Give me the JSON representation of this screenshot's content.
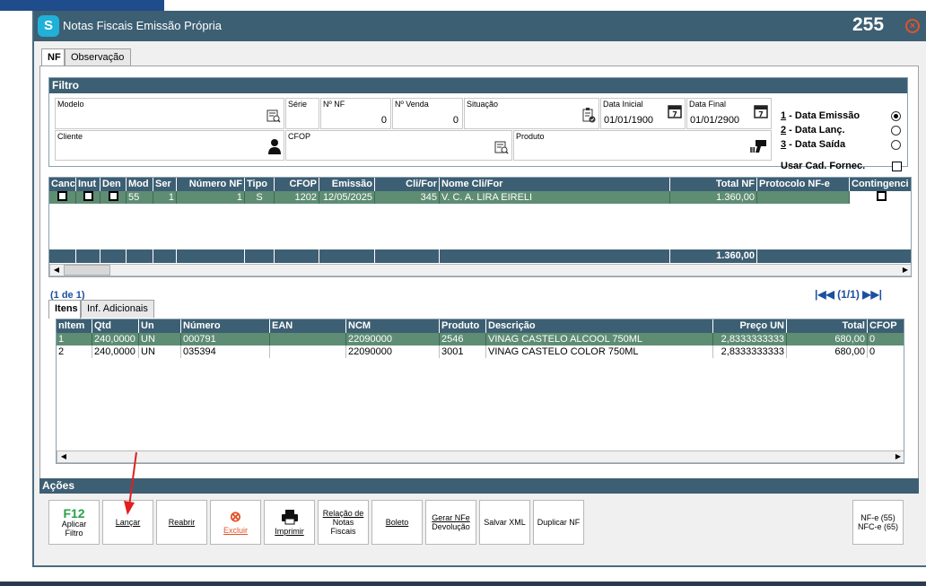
{
  "window": {
    "title": "Notas Fiscais Emissão Própria",
    "number": "255"
  },
  "tabs": [
    {
      "label": "NF",
      "active": true
    },
    {
      "label": "Observação",
      "active": false
    }
  ],
  "filtro": {
    "title": "Filtro",
    "modelo": {
      "label": "Modelo",
      "value": ""
    },
    "serie": {
      "label": "Série",
      "value": ""
    },
    "nnf": {
      "label": "Nº NF",
      "value": "0"
    },
    "nvenda": {
      "label": "Nº Venda",
      "value": "0"
    },
    "situacao": {
      "label": "Situação",
      "value": ""
    },
    "data_inicial": {
      "label": "Data Inicial",
      "value": "01/01/1900"
    },
    "data_final": {
      "label": "Data Final",
      "value": "01/01/2900"
    },
    "cliente": {
      "label": "Cliente",
      "value": ""
    },
    "cfop": {
      "label": "CFOP",
      "value": ""
    },
    "produto": {
      "label": "Produto",
      "value": ""
    },
    "radios": [
      {
        "key": "1",
        "label": " - Data Emissão",
        "checked": true
      },
      {
        "key": "2",
        "label": " - Data Lanç.",
        "checked": false
      },
      {
        "key": "3",
        "label": " - Data Saída",
        "checked": false
      }
    ],
    "usar_cad_fornec": "Usar Cad. Fornec."
  },
  "nf_grid": {
    "headers": [
      "Canc",
      "Inut",
      "Den",
      "Mod",
      "Ser",
      "Número NF",
      "Tipo",
      "CFOP",
      "Emissão",
      "Cli/For",
      "Nome Cli/For",
      "Total NF",
      "Protocolo NF-e",
      "Contingenci"
    ],
    "rows": [
      {
        "mod": "55",
        "ser": "1",
        "numero": "1",
        "tipo": "S",
        "cfop": "1202",
        "emissao": "12/05/2025",
        "clifor": "345",
        "nome": "V. C. A. LIRA EIRELI",
        "total": "1.360,00",
        "protocolo": ""
      }
    ],
    "footer_total": "1.360,00",
    "pager_left": "(1 de 1)",
    "pager_right": "(1/1)"
  },
  "item_tabs": [
    {
      "label": "Itens",
      "active": true
    },
    {
      "label": "Inf. Adicionais",
      "active": false
    }
  ],
  "items_grid": {
    "headers": [
      "nItem",
      "Qtd",
      "Un",
      "Número",
      "EAN",
      "NCM",
      "Produto",
      "Descrição",
      "Preço UN",
      "Total",
      "CFOP"
    ],
    "rows": [
      {
        "nitem": "1",
        "qtd": "240,0000",
        "un": "UN",
        "numero": "000791",
        "ean": "",
        "ncm": "22090000",
        "produto": "2546",
        "descricao": "VINAG CASTELO ALCOOL 750ML",
        "preco": "2,8333333333",
        "total": "680,00",
        "cfop": "0"
      },
      {
        "nitem": "2",
        "qtd": "240,0000",
        "un": "UN",
        "numero": "035394",
        "ean": "",
        "ncm": "22090000",
        "produto": "3001",
        "descricao": "VINAG CASTELO COLOR 750ML",
        "preco": "2,8333333333",
        "total": "680,00",
        "cfop": "0"
      }
    ]
  },
  "acoes": {
    "title": "Ações",
    "aplicar_icon_text": "F12",
    "aplicar_line1": "Aplicar",
    "aplicar_line2": "Filtro",
    "lancar": "Lançar",
    "reabrir": "Reabrir",
    "excluir": "Excluir",
    "imprimir": "Imprimir",
    "relacao_line1": "Relação de",
    "relacao_line2": "Notas",
    "relacao_line3": "Fiscais",
    "boleto": "Boleto",
    "gerar_line1": "Gerar NFe",
    "gerar_line2": "Devolução",
    "salvar_xml": "Salvar XML",
    "duplicar": "Duplicar NF",
    "nfe_line1": "NF-e (55)",
    "nfe_line2": "NFC-e (65)"
  },
  "colors": {
    "header": "#3d5f73",
    "selected_row": "#5e8d74",
    "pager": "#1d4fa0",
    "arrow": "#e02020"
  }
}
